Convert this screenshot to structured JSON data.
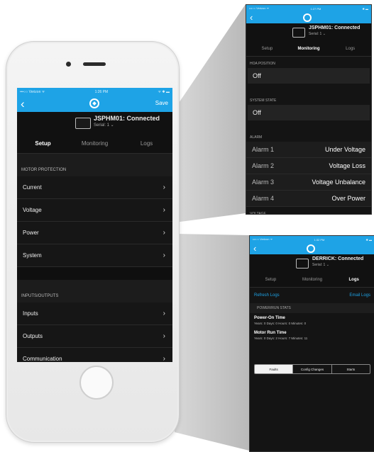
{
  "main_screen": {
    "status": {
      "carrier": "•••○○ Verizon ᯤ",
      "time": "1:26 PM",
      "battery": "ᯤ ✱ ▬"
    },
    "nav": {
      "back_icon": "back-chevron-icon",
      "save_label": "Save"
    },
    "device": {
      "name": "JSPHM01: Connected",
      "serial": "Serial: 1 ⌄"
    },
    "tabs": [
      {
        "label": "Setup",
        "active": true
      },
      {
        "label": "Monitoring",
        "active": false
      },
      {
        "label": "Logs",
        "active": false
      }
    ],
    "sections": [
      {
        "title": "MOTOR PROTECTION",
        "items": [
          "Current",
          "Voltage",
          "Power",
          "System"
        ]
      },
      {
        "title": "INPUTS/OUTPUTS",
        "items": [
          "Inputs",
          "Outputs",
          "Communication"
        ]
      }
    ]
  },
  "zoom_monitoring": {
    "status": {
      "carrier": "•••○○ Verizon ᯤ",
      "time": "1:27 PM",
      "battery": "✱ ▬"
    },
    "device": {
      "name": "JSPHM01: Connected",
      "serial": "Serial: 1 ⌄"
    },
    "tabs": [
      {
        "label": "Setup",
        "active": false
      },
      {
        "label": "Monitoring",
        "active": true
      },
      {
        "label": "Logs",
        "active": false
      }
    ],
    "hoa_label": "HOA POSITION",
    "hoa_value": "Off",
    "system_state_label": "SYSTEM STATE",
    "system_state_value": "Off",
    "alarm_label": "ALARM",
    "alarms": [
      {
        "name": "Alarm 1",
        "value": "Under Voltage"
      },
      {
        "name": "Alarm 2",
        "value": "Voltage Loss"
      },
      {
        "name": "Alarm 3",
        "value": "Voltage Unbalance"
      },
      {
        "name": "Alarm 4",
        "value": "Over Power"
      }
    ],
    "voltage_label": "VOLTAGE"
  },
  "zoom_logs": {
    "status": {
      "carrier": "•••○○ Verizon ᯤ",
      "time": "1:32 PM",
      "battery": "✱ ▬"
    },
    "device": {
      "name": "DERRICK: Connected",
      "serial": "Serial: 1 ⌄"
    },
    "tabs": [
      {
        "label": "Setup",
        "active": false
      },
      {
        "label": "Monitoring",
        "active": false
      },
      {
        "label": "Logs",
        "active": true
      }
    ],
    "refresh_label": "Refresh Logs",
    "email_label": "Email Logs",
    "stats_title": "POWER/RUN STATS",
    "power_on_title": "Power-On Time",
    "power_on_value": "Years: 0 Days: 0 Hours: 0 Minutes: 0",
    "motor_run_title": "Motor Run Time",
    "motor_run_value": "Years: 0 Days: 2 Hours: 7 Minutes: 11",
    "segments": [
      "Faults",
      "Config Changes",
      "Starts"
    ]
  },
  "colors": {
    "accent": "#1ea3e6",
    "background": "#121212",
    "phone_body": "#f0f0f0"
  }
}
